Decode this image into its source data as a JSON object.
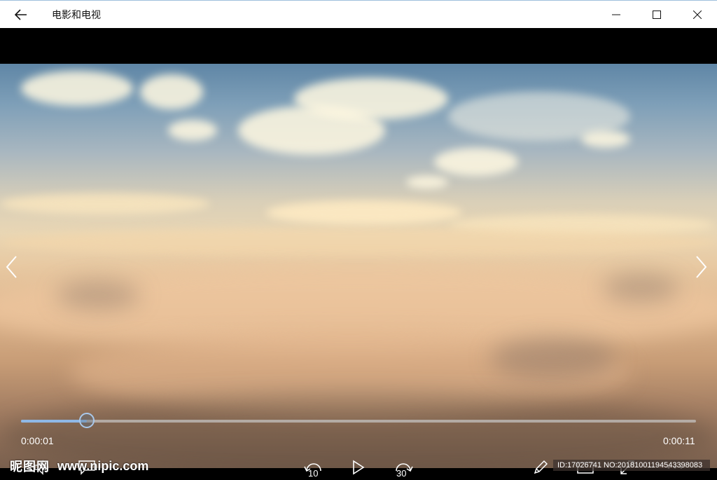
{
  "window": {
    "title": "电影和电视",
    "icons": {
      "back": "back-arrow-icon",
      "minimize": "minimize-icon",
      "maximize": "maximize-icon",
      "close": "close-icon"
    }
  },
  "player": {
    "current_time": "0:00:01",
    "total_time": "0:00:11",
    "progress": 0.098,
    "controls": {
      "volume_icon": "volume-icon",
      "subtitles_icon": "subtitles-icon",
      "skip_back_label": "10",
      "play_icon": "play-icon",
      "skip_forward_label": "30",
      "edit_icon": "pencil-icon",
      "cast_icon": "cast-icon",
      "fullscreen_icon": "fullscreen-icon",
      "more_icon": "more-icon"
    },
    "nav": {
      "prev_icon": "chevron-left-icon",
      "next_icon": "chevron-right-icon"
    }
  },
  "watermark": {
    "logo": "昵图网",
    "url": "www.nipic.com",
    "id_text": "ID:17026741 NO:20181001194543398083"
  }
}
